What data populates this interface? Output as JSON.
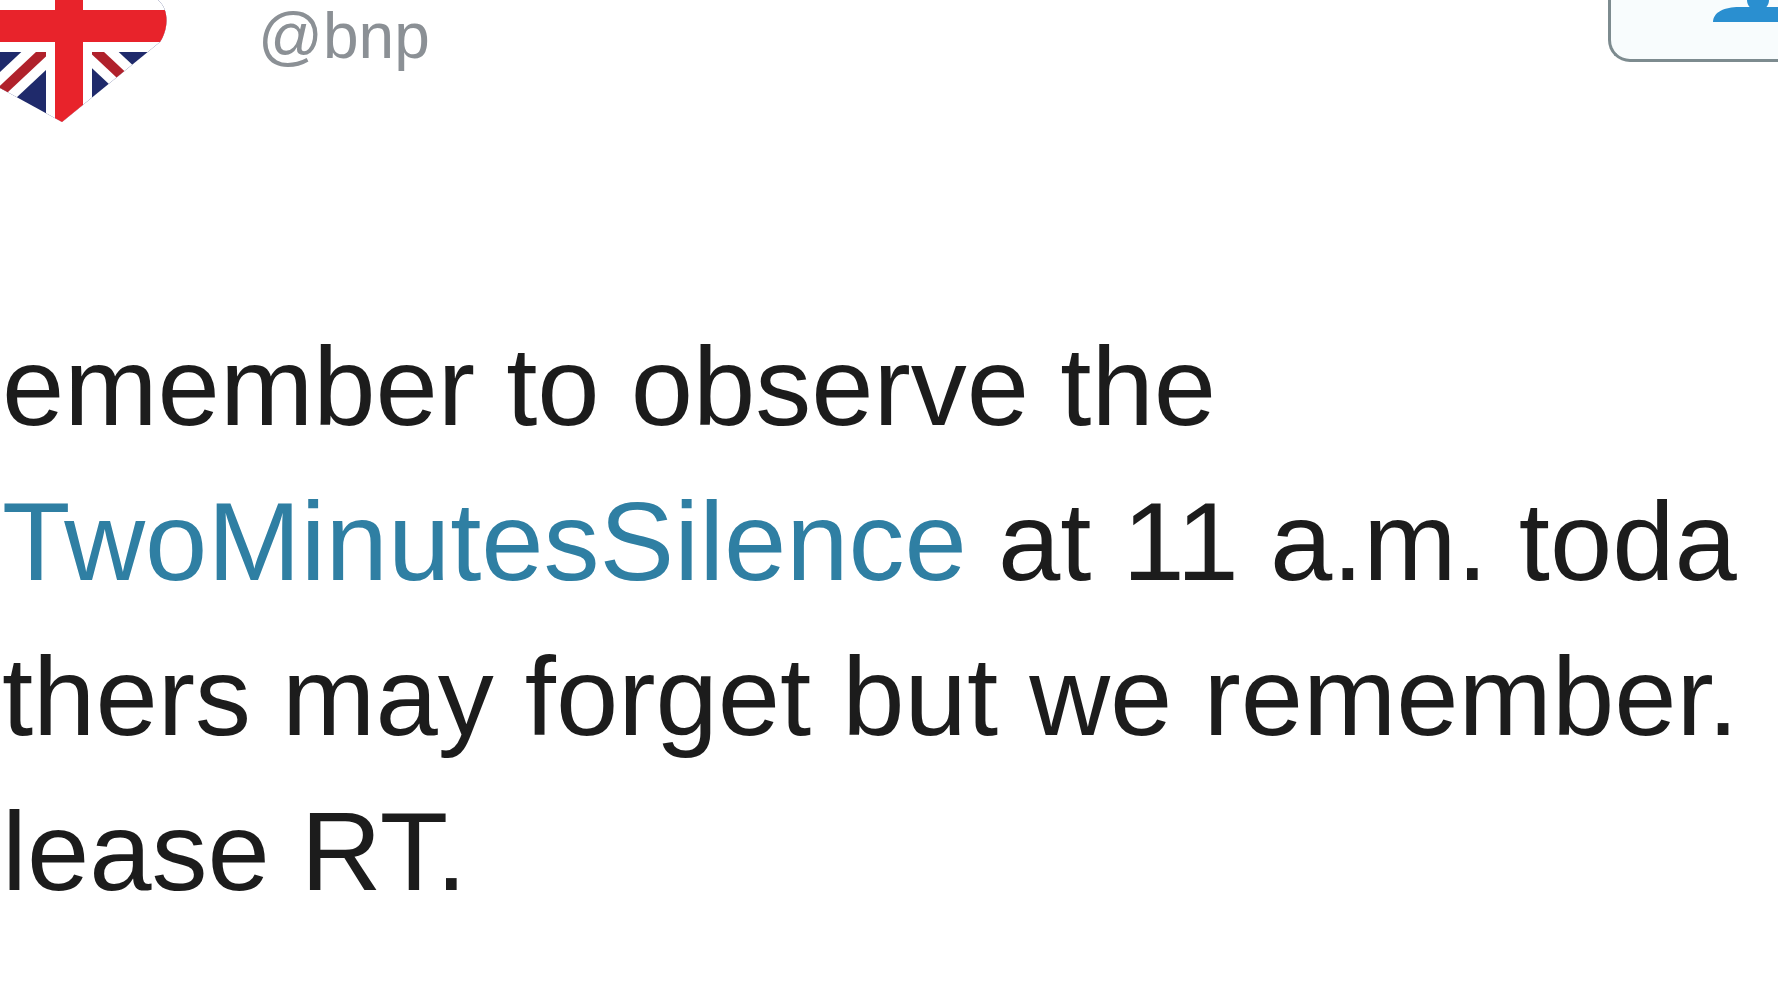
{
  "profile": {
    "handle": "@bnp"
  },
  "tweet": {
    "lines": [
      {
        "segments": [
          {
            "kind": "text",
            "text": "emember to observe the"
          }
        ]
      },
      {
        "segments": [
          {
            "kind": "hashtag",
            "text": "TwoMinutesSilence"
          },
          {
            "kind": "text",
            "text": " at 11 a.m. toda"
          }
        ]
      },
      {
        "segments": [
          {
            "kind": "text",
            "text": "thers may forget but we remember."
          }
        ]
      },
      {
        "segments": [
          {
            "kind": "text",
            "text": "lease RT."
          }
        ]
      }
    ]
  }
}
